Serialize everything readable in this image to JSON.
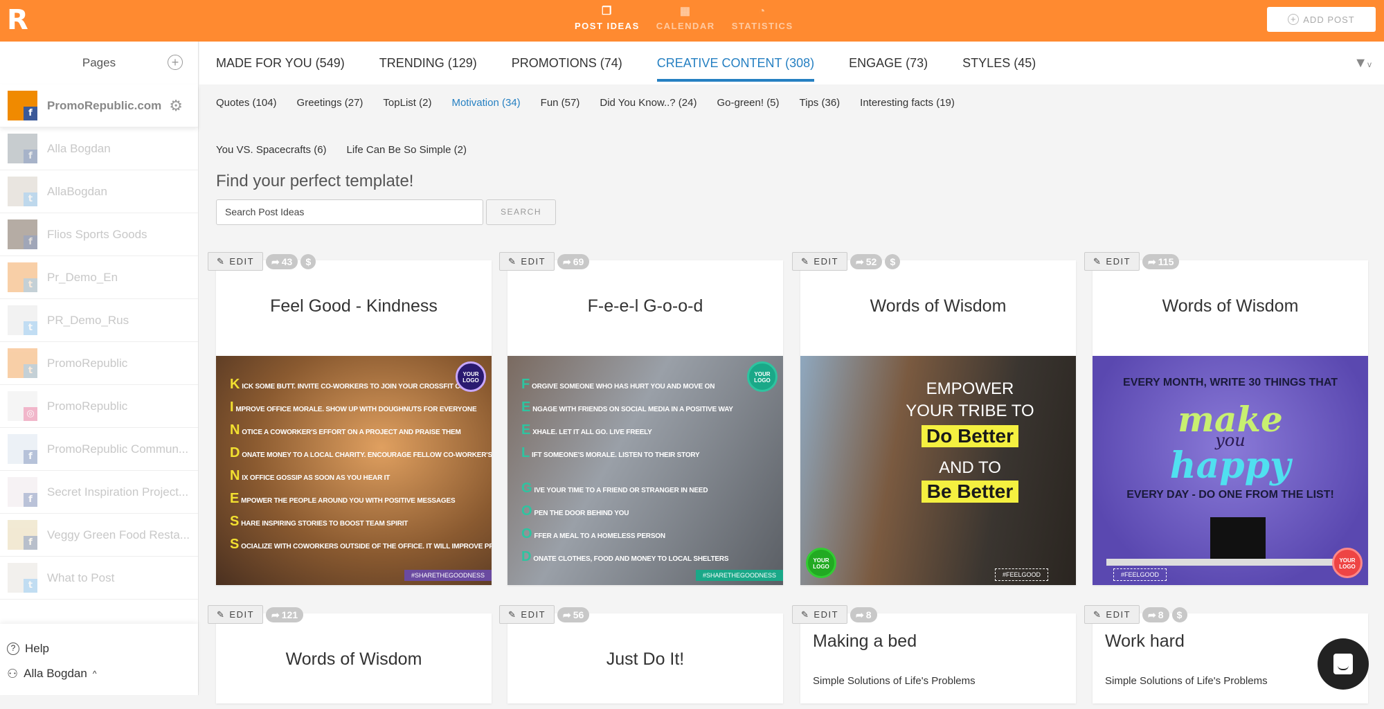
{
  "header": {
    "nav": [
      {
        "label": "POST IDEAS",
        "icon": "post-ideas-icon",
        "active": true
      },
      {
        "label": "CALENDAR",
        "icon": "calendar-icon"
      },
      {
        "label": "STATISTICS",
        "icon": "statistics-icon"
      }
    ],
    "add_post": "ADD POST",
    "brand_color": "#ff8a30"
  },
  "sidebar": {
    "title": "Pages",
    "pages": [
      {
        "name": "PromoRepublic.com",
        "network": "facebook"
      },
      {
        "name": "Alla Bogdan",
        "network": "facebook"
      },
      {
        "name": "AllaBogdan",
        "network": "twitter"
      },
      {
        "name": "Flios Sports Goods",
        "network": "facebook"
      },
      {
        "name": "Pr_Demo_En",
        "network": "twitter"
      },
      {
        "name": "PR_Demo_Rus",
        "network": "twitter"
      },
      {
        "name": "PromoRepublic",
        "network": "twitter"
      },
      {
        "name": "PromoRepublic",
        "network": "instagram"
      },
      {
        "name": "PromoRepublic Commun...",
        "network": "facebook"
      },
      {
        "name": "Secret Inspiration Project...",
        "network": "facebook"
      },
      {
        "name": "Veggy Green Food Resta...",
        "network": "facebook"
      },
      {
        "name": "What to Post",
        "network": "twitter"
      }
    ],
    "help": "Help",
    "user": "Alla Bogdan"
  },
  "tabs": [
    {
      "label": "MADE FOR YOU (549)"
    },
    {
      "label": "TRENDING (129)"
    },
    {
      "label": "PROMOTIONS (74)"
    },
    {
      "label": "CREATIVE CONTENT (308)",
      "active": true
    },
    {
      "label": "ENGAGE (73)"
    },
    {
      "label": "STYLES (45)"
    }
  ],
  "subcategories": [
    "Quotes (104)",
    "Greetings (27)",
    "TopList (2)",
    "Motivation (34)",
    "Fun (57)",
    "Did You Know..? (24)",
    "Go-green! (5)",
    "Tips (36)",
    "Interesting facts (19)"
  ],
  "subcategories_row2": [
    "You VS. Spacecrafts (6)",
    "Life Can Be So Simple (2)"
  ],
  "active_subcategory": "Motivation (34)",
  "search": {
    "heading": "Find your perfect template!",
    "placeholder": "Search Post Ideas",
    "button": "SEARCH"
  },
  "edit_label": "EDIT",
  "cards": [
    {
      "title": "Feel Good - Kindness",
      "shares": "43",
      "paid": true,
      "image": {
        "lines": [
          [
            "K",
            "ICK SOME BUTT. INVITE CO-WORKERS TO JOIN YOUR CROSSFIT CLASS"
          ],
          [
            "I",
            "MPROVE OFFICE MORALE. SHOW UP WITH DOUGHNUTS FOR EVERYONE"
          ],
          [
            "N",
            "OTICE A COWORKER'S EFFORT ON A PROJECT AND PRAISE THEM"
          ],
          [
            "D",
            "ONATE MONEY TO A LOCAL CHARITY. ENCOURAGE FELLOW CO-WORKER'S TO DO THE SAME"
          ],
          [
            "N",
            "IX OFFICE GOSSIP AS SOON AS YOU HEAR IT"
          ],
          [
            "E",
            "MPOWER THE PEOPLE AROUND YOU WITH POSITIVE MESSAGES"
          ],
          [
            "S",
            "HARE INSPIRING STORIES TO BOOST TEAM SPIRIT"
          ],
          [
            "S",
            "OCIALIZE WITH COWORKERS OUTSIDE OF THE OFFICE. IT WILL IMPROVE PRODUCTIVITY"
          ]
        ],
        "logo": "YOUR LOGO",
        "tag": "#SHARETHEGOODNESS"
      }
    },
    {
      "title": "F-e-e-l G-o-o-d",
      "shares": "69",
      "paid": false,
      "image": {
        "lines": [
          [
            "F",
            "ORGIVE SOMEONE WHO HAS HURT YOU AND MOVE ON"
          ],
          [
            "E",
            "NGAGE WITH FRIENDS ON SOCIAL MEDIA IN A POSITIVE WAY"
          ],
          [
            "E",
            "XHALE. LET IT ALL GO. LIVE FREELY"
          ],
          [
            "L",
            "IFT SOMEONE'S MORALE. LISTEN TO THEIR STORY"
          ],
          [
            "G",
            "IVE YOUR TIME TO A FRIEND OR STRANGER IN NEED"
          ],
          [
            "O",
            "PEN THE DOOR BEHIND YOU"
          ],
          [
            "O",
            "FFER A MEAL TO A HOMELESS PERSON"
          ],
          [
            "D",
            "ONATE CLOTHES, FOOD AND MONEY TO LOCAL SHELTERS"
          ]
        ],
        "logo": "YOUR LOGO",
        "tag": "#SHARETHEGOODNESS"
      }
    },
    {
      "title": "Words of Wisdom",
      "shares": "52",
      "paid": true,
      "image": {
        "l1": "EMPOWER",
        "l2": "YOUR TRIBE TO",
        "l3": "Do Better",
        "l4": "AND TO",
        "l5": "Be Better",
        "logo": "YOUR LOGO",
        "tag": "#FEELGOOD"
      }
    },
    {
      "title": "Words of Wisdom",
      "shares": "115",
      "paid": false,
      "image": {
        "l1": "EVERY MONTH, WRITE 30 THINGS THAT",
        "l2": "make",
        "l3": "you",
        "l4": "happy",
        "l5": "EVERY DAY - DO ONE FROM THE LIST!",
        "logo": "YOUR LOGO",
        "tag": "#FEELGOOD"
      }
    },
    {
      "title": "Words of Wisdom",
      "shares": "121",
      "paid": false
    },
    {
      "title": "Just Do It!",
      "shares": "56",
      "paid": false
    },
    {
      "title": "Making a bed",
      "shares": "8",
      "paid": false,
      "subtitle": "Simple Solutions of Life's Problems"
    },
    {
      "title": "Work hard",
      "shares": "8",
      "paid": true,
      "subtitle": "Simple Solutions of Life's Problems"
    }
  ]
}
